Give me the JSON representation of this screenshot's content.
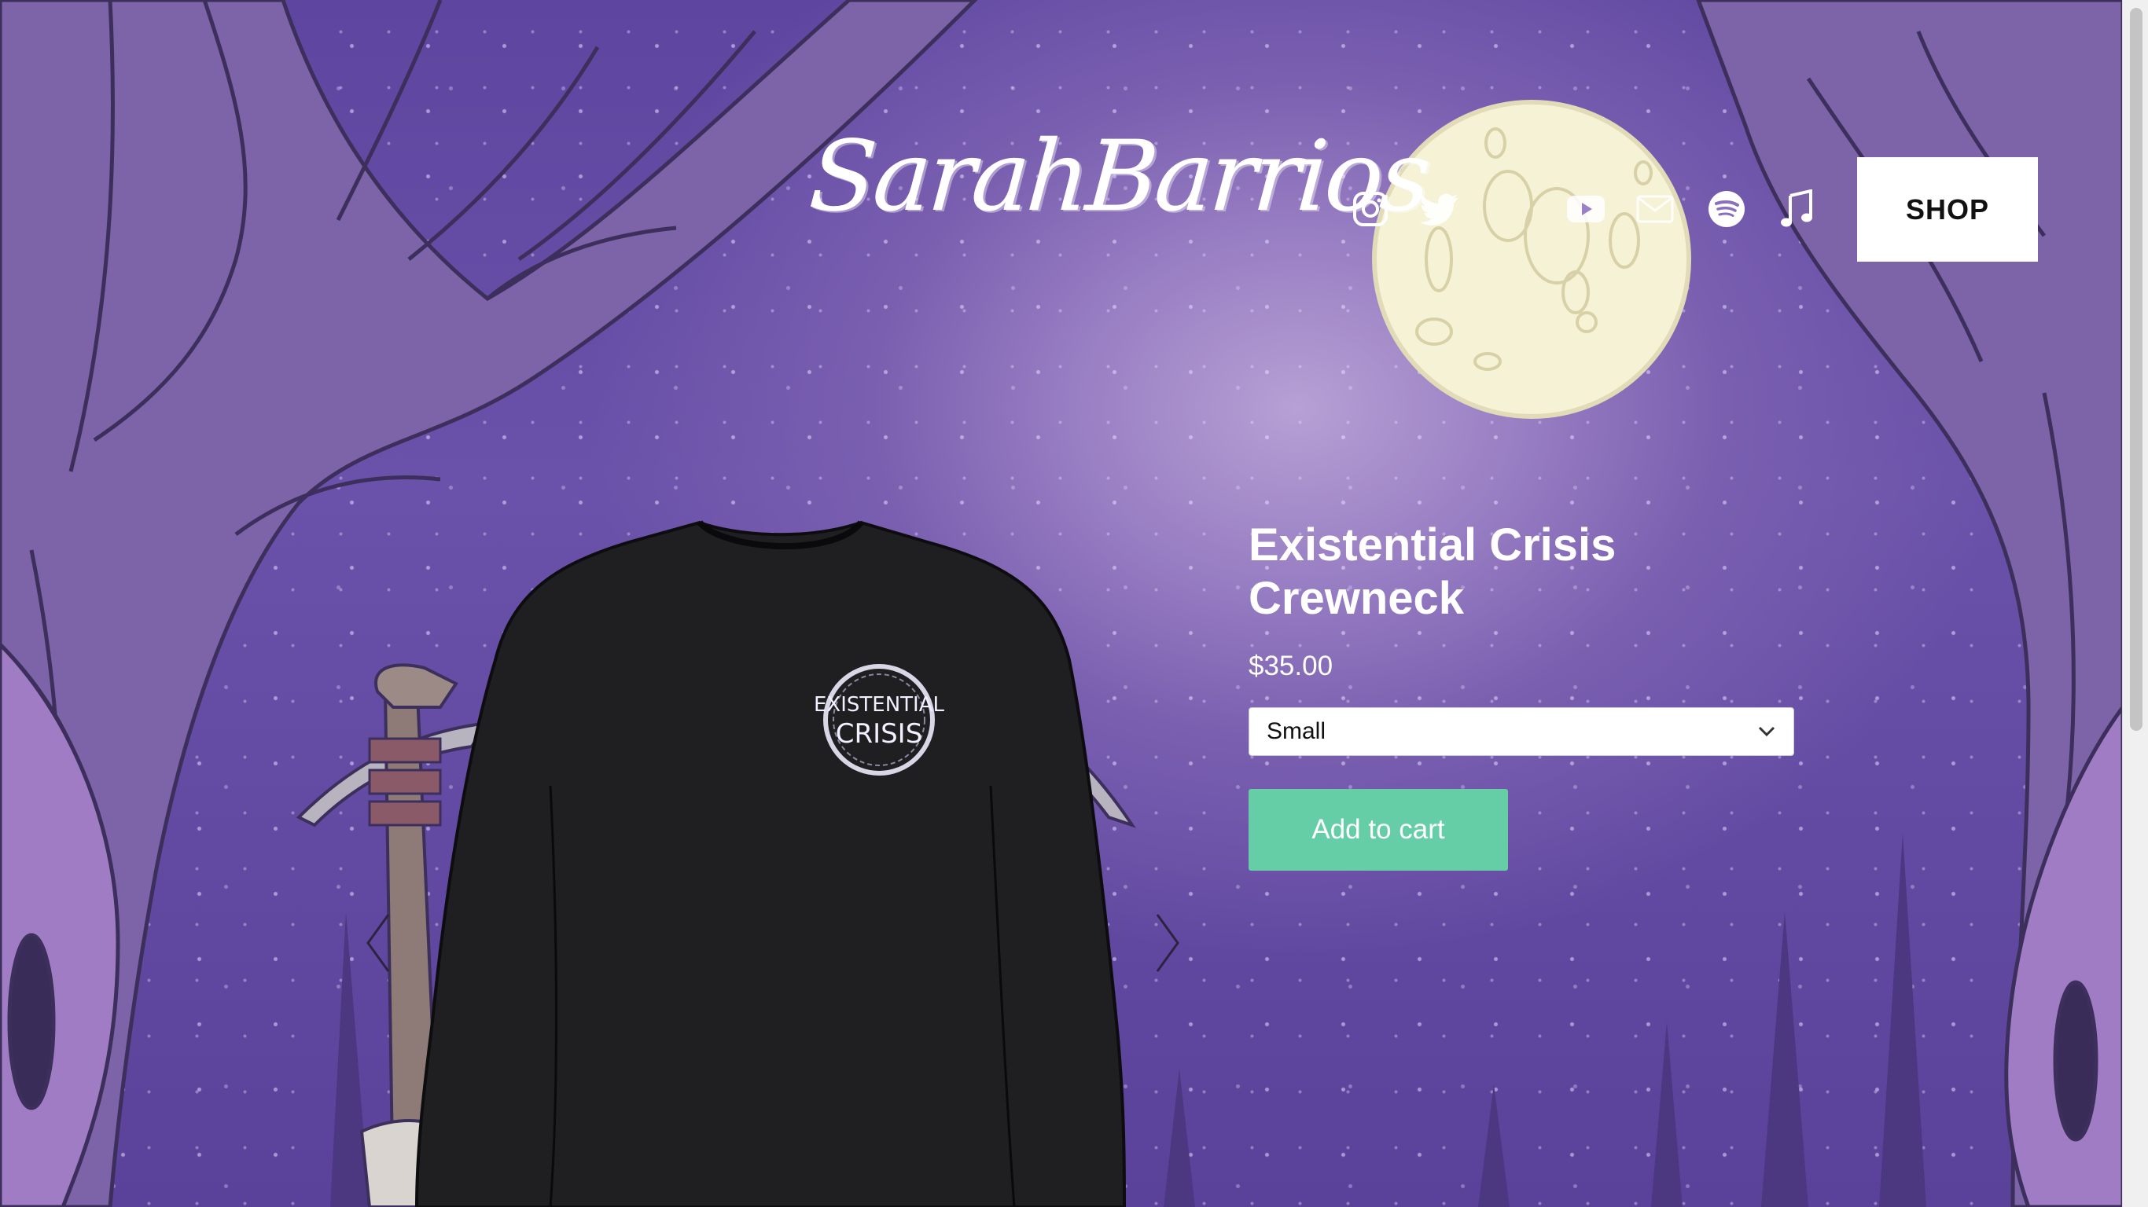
{
  "header": {
    "logo_text": "SarahBarrios",
    "social_icons": [
      "instagram-icon",
      "twitter-icon",
      "youtube-icon",
      "email-icon",
      "spotify-icon",
      "music-note-icon"
    ],
    "shop_label": "SHOP"
  },
  "product": {
    "title": "Existential Crisis Crewneck",
    "price": "$35.00",
    "size_selected": "Small",
    "add_to_cart_label": "Add to cart",
    "badge_text_line1": "EXISTENTIAL",
    "badge_text_line2": "CRISIS"
  },
  "colors": {
    "background": "#6a52aa",
    "accent": "#66cea6",
    "moon": "#f6f2d6"
  }
}
